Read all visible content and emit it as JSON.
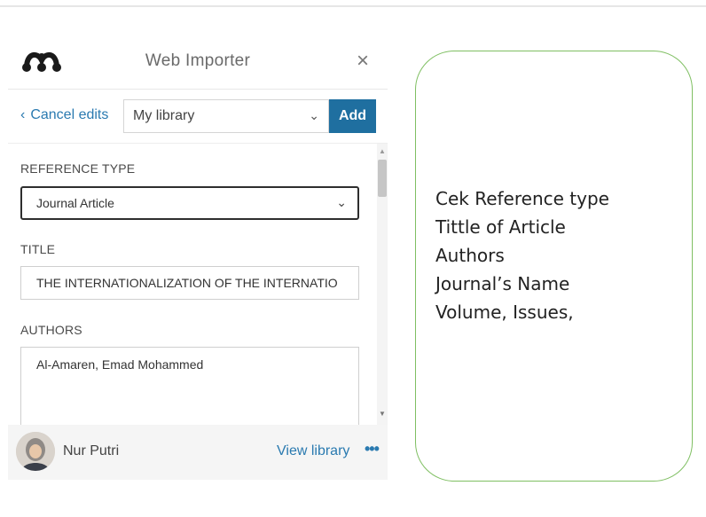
{
  "importer": {
    "title": "Web Importer",
    "close_icon": "close-icon",
    "logo_icon": "mendeley-logo-icon",
    "toolbar": {
      "cancel_label": "Cancel edits",
      "library_value": "My library",
      "add_label": "Add"
    },
    "form": {
      "reference_type_label": "REFERENCE TYPE",
      "reference_type_value": "Journal Article",
      "title_label": "TITLE",
      "title_value": "THE INTERNATIONALIZATION OF THE INTERNATIO",
      "authors_label": "AUTHORS",
      "authors_value": "Al-Amaren, Emad Mohammed"
    },
    "footer": {
      "user_name": "Nur Putri",
      "view_library_label": "View library",
      "more_icon": "more-dots-icon"
    }
  },
  "note": {
    "lines": [
      "Cek Reference type",
      "Tittle of Article",
      "Authors",
      "Journal’s Name",
      "Volume, Issues,"
    ]
  },
  "colors": {
    "accent": "#1f6fa0",
    "link": "#2a7ab0",
    "note_border": "#7fbf62"
  }
}
